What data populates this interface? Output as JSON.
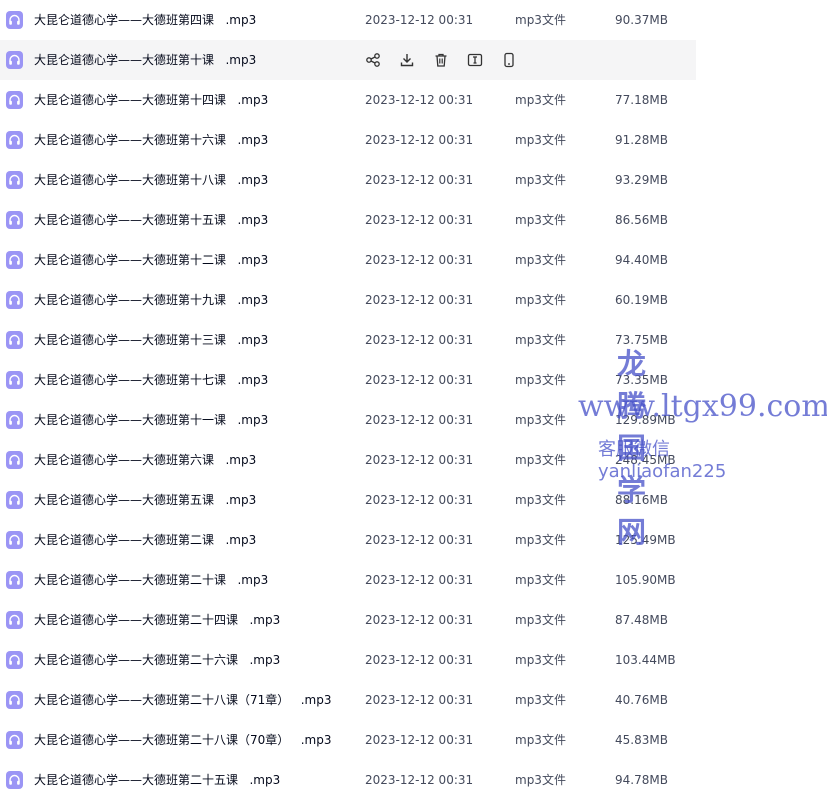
{
  "files": [
    {
      "name": "大昆仑道德心学——大德班第四课   .mp3",
      "date": "2023-12-12 00:31",
      "type": "mp3文件",
      "size": "90.37MB"
    },
    {
      "name": "大昆仑道德心学——大德班第十课   .mp3",
      "date": "",
      "type": "",
      "size": "",
      "hover": true
    },
    {
      "name": "大昆仑道德心学——大德班第十四课   .mp3",
      "date": "2023-12-12 00:31",
      "type": "mp3文件",
      "size": "77.18MB"
    },
    {
      "name": "大昆仑道德心学——大德班第十六课   .mp3",
      "date": "2023-12-12 00:31",
      "type": "mp3文件",
      "size": "91.28MB"
    },
    {
      "name": "大昆仑道德心学——大德班第十八课   .mp3",
      "date": "2023-12-12 00:31",
      "type": "mp3文件",
      "size": "93.29MB"
    },
    {
      "name": "大昆仑道德心学——大德班第十五课   .mp3",
      "date": "2023-12-12 00:31",
      "type": "mp3文件",
      "size": "86.56MB"
    },
    {
      "name": "大昆仑道德心学——大德班第十二课   .mp3",
      "date": "2023-12-12 00:31",
      "type": "mp3文件",
      "size": "94.40MB"
    },
    {
      "name": "大昆仑道德心学——大德班第十九课   .mp3",
      "date": "2023-12-12 00:31",
      "type": "mp3文件",
      "size": "60.19MB"
    },
    {
      "name": "大昆仑道德心学——大德班第十三课   .mp3",
      "date": "2023-12-12 00:31",
      "type": "mp3文件",
      "size": "73.75MB"
    },
    {
      "name": "大昆仑道德心学——大德班第十七课   .mp3",
      "date": "2023-12-12 00:31",
      "type": "mp3文件",
      "size": "73.35MB"
    },
    {
      "name": "大昆仑道德心学——大德班第十一课   .mp3",
      "date": "2023-12-12 00:31",
      "type": "mp3文件",
      "size": "129.89MB"
    },
    {
      "name": "大昆仑道德心学——大德班第六课   .mp3",
      "date": "2023-12-12 00:31",
      "type": "mp3文件",
      "size": "248.45MB"
    },
    {
      "name": "大昆仑道德心学——大德班第五课   .mp3",
      "date": "2023-12-12 00:31",
      "type": "mp3文件",
      "size": "88.16MB"
    },
    {
      "name": "大昆仑道德心学——大德班第二课   .mp3",
      "date": "2023-12-12 00:31",
      "type": "mp3文件",
      "size": "125.49MB"
    },
    {
      "name": "大昆仑道德心学——大德班第二十课   .mp3",
      "date": "2023-12-12 00:31",
      "type": "mp3文件",
      "size": "105.90MB"
    },
    {
      "name": "大昆仑道德心学——大德班第二十四课   .mp3",
      "date": "2023-12-12 00:31",
      "type": "mp3文件",
      "size": "87.48MB"
    },
    {
      "name": "大昆仑道德心学——大德班第二十六课   .mp3",
      "date": "2023-12-12 00:31",
      "type": "mp3文件",
      "size": "103.44MB"
    },
    {
      "name": "大昆仑道德心学——大德班第二十八课（71章）   .mp3",
      "date": "2023-12-12 00:31",
      "type": "mp3文件",
      "size": "40.76MB"
    },
    {
      "name": "大昆仑道德心学——大德班第二十八课（70章）   .mp3",
      "date": "2023-12-12 00:31",
      "type": "mp3文件",
      "size": "45.83MB"
    },
    {
      "name": "大昆仑道德心学——大德班第二十五课   .mp3",
      "date": "2023-12-12 00:31",
      "type": "mp3文件",
      "size": "94.78MB"
    }
  ],
  "hover_actions": [
    "share-icon",
    "download-icon",
    "delete-icon",
    "rename-icon",
    "phone-icon"
  ],
  "watermark": {
    "line1": "龙腾国学网",
    "line2": "www.ltgx99.com",
    "line3": "客服微信 yanliaofan225"
  },
  "colors": {
    "file_icon": "#9b95f5",
    "hover_row": "#f5f5f6",
    "watermark": "#4650c8"
  }
}
